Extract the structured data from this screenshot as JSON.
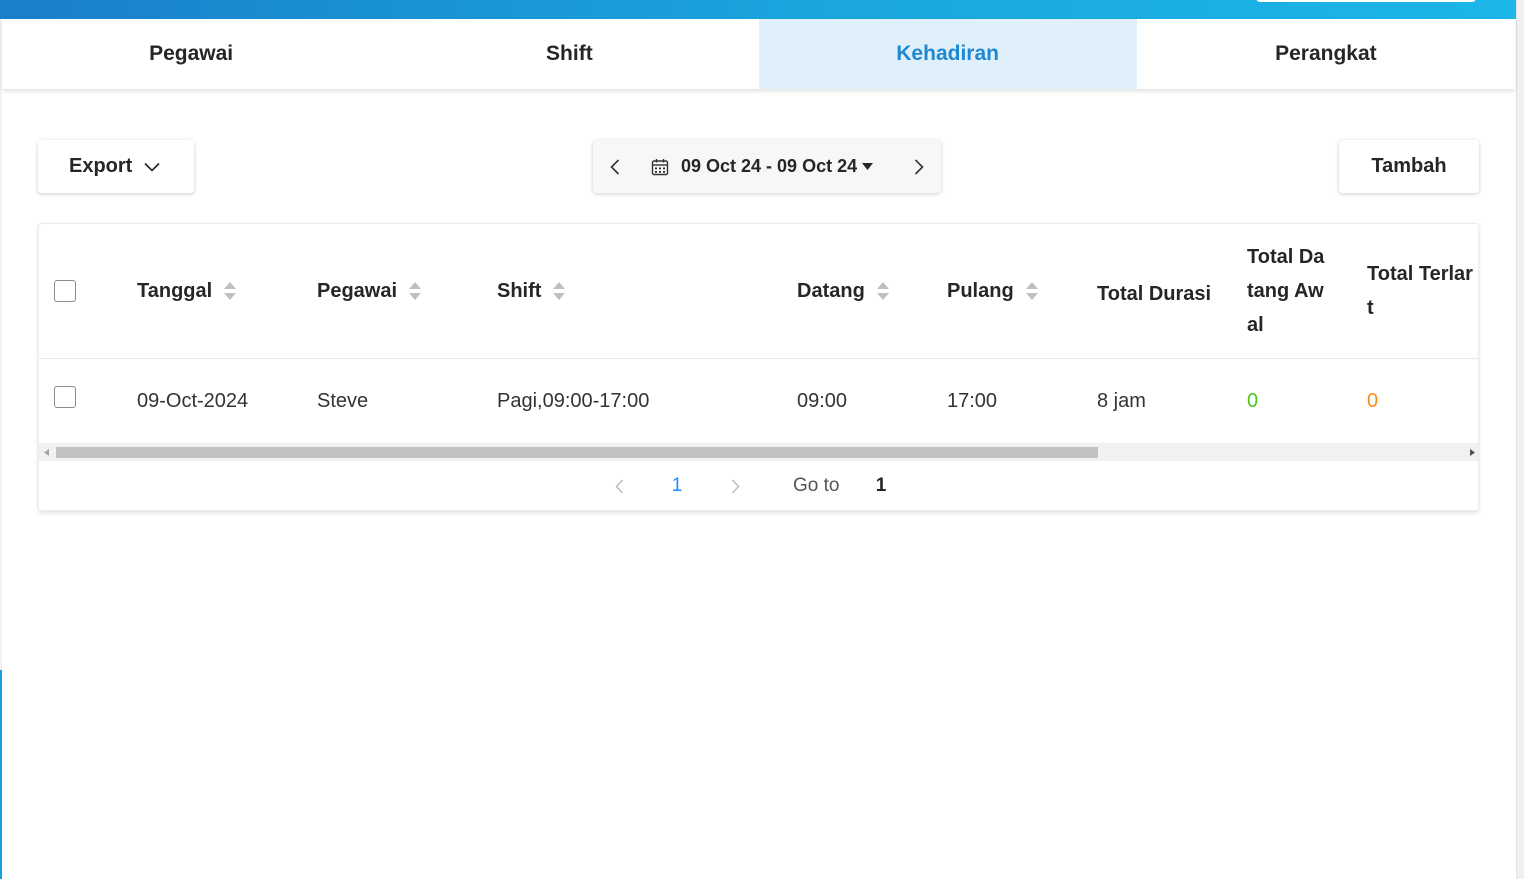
{
  "tabs": [
    {
      "label": "Pegawai",
      "active": false
    },
    {
      "label": "Shift",
      "active": false
    },
    {
      "label": "Kehadiran",
      "active": true
    },
    {
      "label": "Perangkat",
      "active": false
    }
  ],
  "toolbar": {
    "export_label": "Export",
    "date_range": "09 Oct 24 - 09 Oct 24",
    "add_label": "Tambah"
  },
  "table": {
    "columns": {
      "tanggal": "Tanggal",
      "pegawai": "Pegawai",
      "shift": "Shift",
      "datang": "Datang",
      "pulang": "Pulang",
      "total_durasi": "Total Durasi",
      "total_datang_awal_1": "Total Da",
      "total_datang_awal_2": "tang Aw",
      "total_datang_awal_3": "al",
      "total_terlambat_1": "Total Terlar",
      "total_terlambat_2": "t"
    },
    "rows": [
      {
        "tanggal": "09-Oct-2024",
        "pegawai": "Steve",
        "shift": "Pagi,09:00-17:00",
        "datang": "09:00",
        "pulang": "17:00",
        "total_durasi": "8 jam",
        "total_datang_awal": "0",
        "total_terlambat": "0"
      }
    ]
  },
  "pagination": {
    "current_page": "1",
    "goto_label": "Go to",
    "goto_value": "1"
  },
  "colors": {
    "accent": "#1e88d2",
    "active_tab_bg": "#dff0fb",
    "early_value": "#52c41a",
    "late_value": "#fa8c16"
  }
}
